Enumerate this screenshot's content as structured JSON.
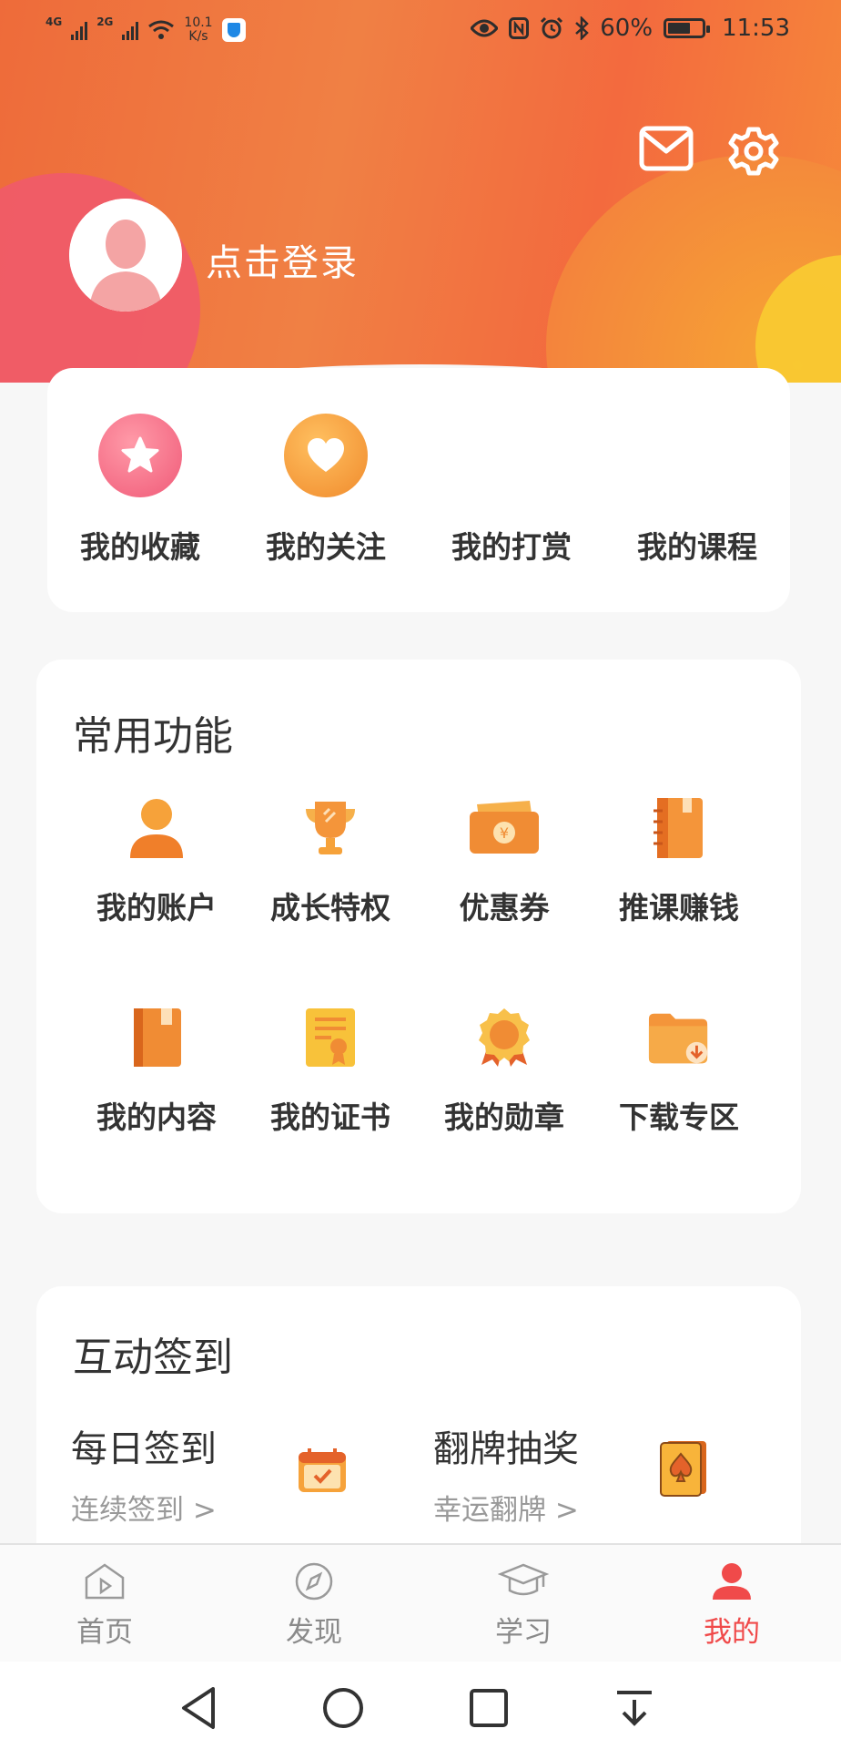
{
  "status_bar": {
    "net1": "4G",
    "net2": "2G",
    "speed_value": "10.1",
    "speed_unit": "K/s",
    "battery": "60%",
    "time": "11:53"
  },
  "header": {
    "login_text": "点击登录",
    "mail_icon": "mail-icon",
    "settings_icon": "gear-icon"
  },
  "quick_links": [
    {
      "label": "我的收藏",
      "icon": "star-icon"
    },
    {
      "label": "我的关注",
      "icon": "heart-icon"
    },
    {
      "label": "我的打赏",
      "icon": ""
    },
    {
      "label": "我的课程",
      "icon": ""
    }
  ],
  "common": {
    "title": "常用功能",
    "items": [
      {
        "label": "我的账户",
        "icon": "user-icon"
      },
      {
        "label": "成长特权",
        "icon": "trophy-icon"
      },
      {
        "label": "优惠券",
        "icon": "coupon-icon"
      },
      {
        "label": "推课赚钱",
        "icon": "notebook-icon"
      },
      {
        "label": "我的内容",
        "icon": "book-icon"
      },
      {
        "label": "我的证书",
        "icon": "certificate-icon"
      },
      {
        "label": "我的勋章",
        "icon": "medal-icon"
      },
      {
        "label": "下载专区",
        "icon": "download-folder-icon"
      }
    ]
  },
  "interactive": {
    "title": "互动签到",
    "daily": {
      "title": "每日签到",
      "sub": "连续签到 >"
    },
    "flip": {
      "title": "翻牌抽奖",
      "sub": "幸运翻牌 >"
    }
  },
  "bottom_nav": [
    {
      "label": "首页",
      "icon": "home-play-icon",
      "active": false
    },
    {
      "label": "发现",
      "icon": "compass-icon",
      "active": false
    },
    {
      "label": "学习",
      "icon": "graduation-cap-icon",
      "active": false
    },
    {
      "label": "我的",
      "icon": "profile-icon",
      "active": true
    }
  ],
  "colors": {
    "accent": "#f04a4a",
    "orange": "#f0883a",
    "header_start": "#ee6b3a",
    "header_end": "#f6893a"
  }
}
